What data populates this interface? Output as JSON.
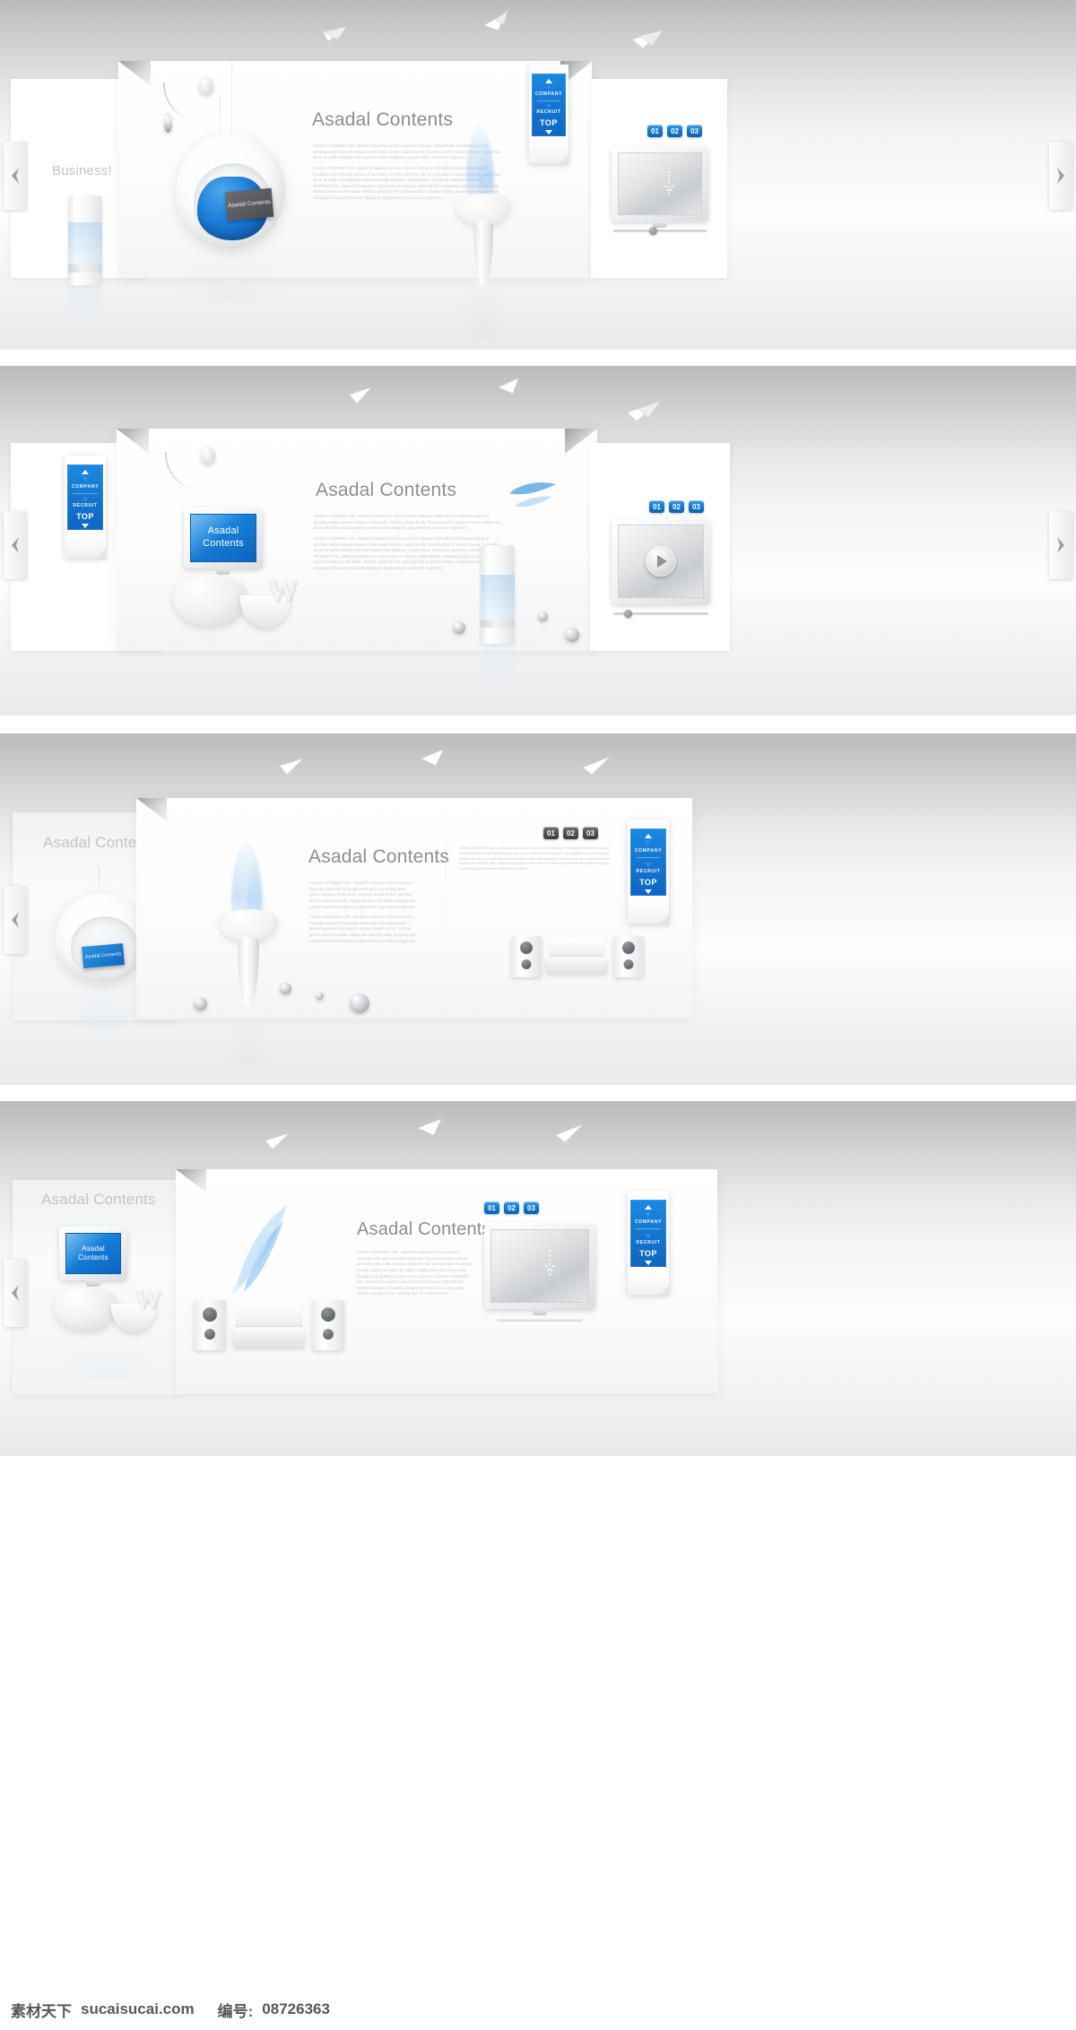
{
  "document": {
    "title": "Asadal Contents - white 3D interior web banner templates",
    "panel_count": 4
  },
  "shared": {
    "brand_blue": "#1278d2",
    "heading_gray": "#8d8f92",
    "body_gray": "#c8cacd",
    "headline": "Asadal Contents",
    "sidenav": {
      "company_label": "COMPANY",
      "recruit_label": "RECRUIT",
      "top_label": "TOP",
      "up_icon": "triangle-up-icon",
      "down_icon": "triangle-down-icon",
      "company_icon": "dotted-pin-icon",
      "recruit_icon": "dotted-heart-icon"
    },
    "badges": [
      "01",
      "02",
      "03"
    ],
    "arrows": {
      "prev_icon": "chevron-left-icon",
      "next_icon": "chevron-right-icon"
    },
    "paragraphs": [
      "ASADAL INTERNET, INC. started its business in Seou Korea in February 1998 with the fundamental goal of providing better internet services to the world. ASADAL stands for the \"morning land\" in ancient Korean. Asadal has about 35 staffs including well experienced web designers, programmers, and server engineers.",
      "ASADAL INTERNET, INC. started its business in Seou Korea in February 1998 with the fundamental goal of providing better internet services to the world. ASADAL stands for the \"morning land\" in ancient Korean. Asadal has about 35 staffs including well experienced web designers, programmers, and server engineers. ASADAL INTERNET, INC. started its business in Seou Korea in February 1998 with the fundamental goal of providing better internet services to the world. ASADAL stands for the \"morning land\" in ancient Korean. Asadal has about 35 staffs including well experienced web designers, programmers, and server engineers."
    ]
  },
  "panel1": {
    "side_label": "Business!",
    "headline": "Asadal Contents",
    "body_1": "ASADAL INTERNET, INC. started its business in Seou Korea in February 1998 with the fundamental goal of providing better internet services to the world. ASADAL stands for the \"morning land\" in ancient Korean. Asadal has about 35 staffs including well experienced web designers, programmers, and server engineers.",
    "body_2": "ASADAL INTERNET, INC. started its business in Seou Korea in February 1998 with the fundamental goal of providing better internet services to the world. ASADAL stands for the \"morning land\" in ancient Korean. Asadal has about 35 staffs including well experienced web designers, programmers, and server engineers. ASADAL INTERNET, INC. started its business in Seou Korea in February 1998 with the fundamental goal of providing better internet services to the world. ASADAL stands for the \"morning land\" in ancient Korean. Asadal has about 35 staffs including well experienced web designers, programmers, and server engineers.",
    "chair_tag": "Asadal Contents",
    "badges": [
      "01",
      "02",
      "03"
    ],
    "sidenav": {
      "company": "COMPANY",
      "recruit": "RECRUIT",
      "top": "TOP"
    }
  },
  "panel2": {
    "headline": "Asadal Contents",
    "screen_title": "Asadal Contents",
    "body_1": "ASADAL INTERNET, INC. started its business in Seou Korea in February 1998 with the fundamental goal of providing better internet services to the world. ASADAL stands for the \"morning land\" in ancient Korean. Asadal has about 35 staffs including well experienced web designers, programmers, and server engineers.",
    "body_2": "ASADAL INTERNET, INC. started its business in Seou Korea in February 1998 with the fundamental goal of providing better internet services to the world. ASADAL stands for the \"morning land\" in ancient Korean. Asadal has about 35 staffs including well experienced web designers, programmers, and server engineers. ASADAL INTERNET, INC. started its business in Seou Korea in February 1998 with the fundamental goal of providing better internet services to the world. ASADAL stands for the \"morning land\" in ancient Korean. Asadal has about 35 staffs including well experienced web designers, programmers, and server engineers.",
    "letter_mark": "W",
    "badges": [
      "01",
      "02",
      "03"
    ],
    "sidenav": {
      "company": "COMPANY",
      "recruit": "RECRUIT",
      "top": "TOP"
    },
    "play_icon": "play-icon"
  },
  "panel3": {
    "side_headline": "Asadal Contents",
    "headline": "Asadal Contents",
    "chair_tag": "Asadal Contents",
    "body_1": "ASADAL INTERNET, INC. started its business in Seou Korea in February 1998 with the fundamental goal of providing better internet services to the world. ASADAL stands for the \"morning land\" in ancient Korean. Asadal has about 35 staffs including well experienced web designers, programmers, and server engineers.",
    "body_2": "ASADAL INTERNET, INC. started its business in Seou Korea in February 1998 with the fundamental goal of providing better internet services to the world. ASADAL stands for the \"morning land\" in ancient Korean. Asadal has about 35 staffs including well experienced web designers, programmers, and server engineers.",
    "body_right": "ASADAL INTERNET, INC. started its business in Seou Korea in February 1998 with the fundamental goal of providing better internet services to the world. ASADAL stands for the \"morning land\" in ancient Korean. Asadal has about 35 staffs including well experienced web designers, programmers, and server engineers. ASADAL INTERNET, INC. started its business in Seou Korea in February 1998 with the fundamental goal of providing better internet services to the world.",
    "badges": [
      "01",
      "02",
      "03"
    ],
    "sidenav": {
      "company": "COMPANY",
      "recruit": "RECRUIT",
      "top": "TOP"
    }
  },
  "panel4": {
    "side_headline": "Asadal Contents",
    "headline": "Asadal Contents",
    "screen_title": "Asadal Contents",
    "body_1": "ASADAL INTERNET, INC. started its business in Seou Korea in February 1998 with the fundamental goal of providing better internet services to the world. ASADAL stands for the \"morning land\" in ancient Korean. Asadal has about 35 staffs including well experienced web designers, programmers, and server engineers. ASADAL INTERNET, INC. started its business in Seou Korea in February 1998 with the fundamental goal of providing better internet services to the world. ASADAL stands for the \"morning land\" in ancient Korean.",
    "letter_mark": "W",
    "badges": [
      "01",
      "02",
      "03"
    ],
    "sidenav": {
      "company": "COMPANY",
      "recruit": "RECRUIT",
      "top": "TOP"
    }
  },
  "watermark": {
    "site_cn": "素材天下",
    "site_url": "sucaisucai.com",
    "id_label": "编号:",
    "id_value": "08726363"
  }
}
